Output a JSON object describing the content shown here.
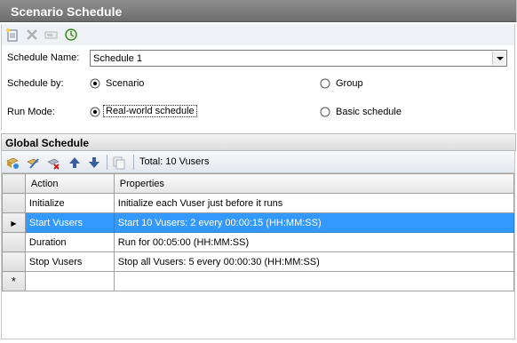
{
  "window": {
    "title": "Scenario Schedule"
  },
  "toolbar_top": {
    "icons": [
      "new-schedule-icon",
      "delete-icon",
      "rename-icon",
      "schedule-clock-icon"
    ]
  },
  "form": {
    "schedule_name_label": "Schedule Name:",
    "schedule_name_value": "Schedule 1",
    "schedule_by_label": "Schedule by:",
    "schedule_by_options": [
      {
        "label": "Scenario",
        "selected": true
      },
      {
        "label": "Group",
        "selected": false
      }
    ],
    "run_mode_label": "Run Mode:",
    "run_mode_options": [
      {
        "label": "Real-world schedule",
        "selected": true
      },
      {
        "label": "Basic schedule",
        "selected": false
      }
    ]
  },
  "global_schedule": {
    "title": "Global Schedule",
    "toolbar_icons": [
      "add-action-icon",
      "edit-action-icon",
      "delete-action-icon",
      "move-up-icon",
      "move-down-icon",
      "copy-icon"
    ],
    "total": "Total: 10 Vusers",
    "columns": [
      "Action",
      "Properties"
    ],
    "rows": [
      {
        "action": "Initialize",
        "properties": "Initialize each Vuser just before it runs",
        "selected": false
      },
      {
        "action": "Start  Vusers",
        "properties": "Start 10 Vusers: 2 every 00:00:15 (HH:MM:SS)",
        "selected": true
      },
      {
        "action": "Duration",
        "properties": "Run for 00:05:00 (HH:MM:SS)",
        "selected": false
      },
      {
        "action": "Stop Vusers",
        "properties": "Stop all Vusers: 5 every 00:00:30 (HH:MM:SS)",
        "selected": false
      }
    ],
    "new_row_marker": "*",
    "selected_row_marker": "▶"
  },
  "colors": {
    "selection": "#3399ff",
    "titlebar": "#7d7d7d"
  }
}
